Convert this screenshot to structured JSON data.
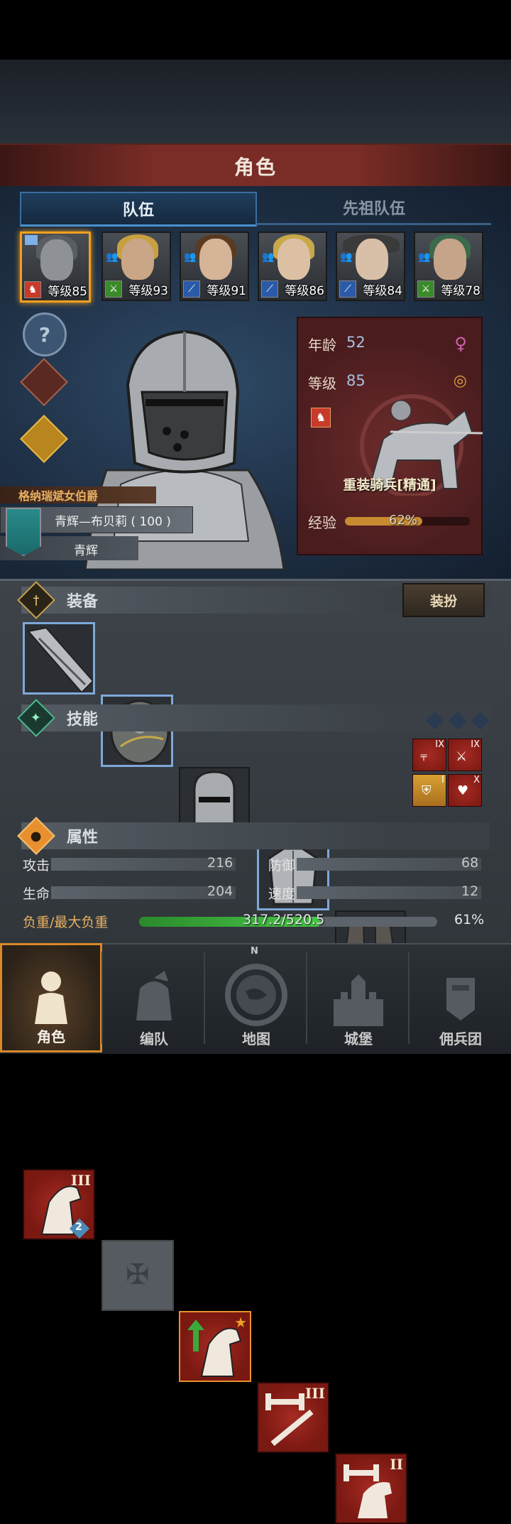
{
  "header": {
    "title": "角色"
  },
  "tabs": [
    {
      "label": "队伍",
      "active": true
    },
    {
      "label": "先祖队伍",
      "active": false
    }
  ],
  "roster": [
    {
      "level": "等级85",
      "class_color": "#c83a2a",
      "selected": true,
      "face": "#8e9296",
      "hair": "#5a5e63"
    },
    {
      "level": "等级93",
      "class_color": "#3a8a2a",
      "selected": false,
      "face": "#c9a686",
      "hair": "#c8a040"
    },
    {
      "level": "等级91",
      "class_color": "#2a5aa8",
      "selected": false,
      "face": "#d6b498",
      "hair": "#5a3a20"
    },
    {
      "level": "等级86",
      "class_color": "#2a5aa8",
      "selected": false,
      "face": "#dcc0a4",
      "hair": "#c8a848"
    },
    {
      "level": "等级84",
      "class_color": "#2a5aa8",
      "selected": false,
      "face": "#d8c0a8",
      "hair": "#3a3a3a"
    },
    {
      "level": "等级78",
      "class_color": "#3a8a2a",
      "selected": false,
      "face": "#c6a48a",
      "hair": "#3a6a4a"
    }
  ],
  "character": {
    "age_label": "年龄",
    "age": "52",
    "level_label": "等级",
    "level": "85",
    "unit_class": "重装骑兵[精通]",
    "exp_label": "经验",
    "exp_percent_text": "62%",
    "exp_fraction": 0.62
  },
  "faction": {
    "title": "格纳瑞斌女伯爵",
    "lord": "青辉—布贝莉 ( 100 )",
    "house": "青辉"
  },
  "equipment": {
    "title": "装备",
    "dress_button": "装扮"
  },
  "skills": {
    "title": "技能",
    "roman": [
      "III",
      "III",
      "II"
    ],
    "badge": "2",
    "mini_roman": [
      "IX",
      "IX",
      "I",
      "X"
    ]
  },
  "attributes": {
    "title": "属性",
    "attack_label": "攻击",
    "attack": "216",
    "defense_label": "防御",
    "defense": "68",
    "hp_label": "生命",
    "hp": "204",
    "speed_label": "速度",
    "speed": "12",
    "load_label": "负重/最大负重",
    "load_text": "317.2/520.5",
    "load_percent": "61%",
    "load_fraction": 0.61
  },
  "nav": [
    {
      "label": "角色",
      "active": true
    },
    {
      "label": "编队",
      "active": false
    },
    {
      "label": "地图",
      "active": false
    },
    {
      "label": "城堡",
      "active": false
    },
    {
      "label": "佣兵团",
      "active": false
    }
  ],
  "compass_letter": "N"
}
